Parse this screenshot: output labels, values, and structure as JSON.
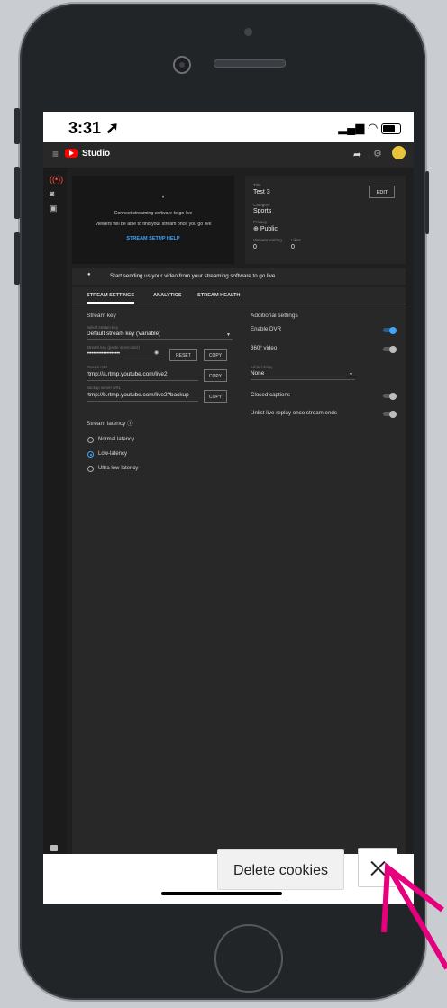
{
  "status_bar": {
    "time": "3:31"
  },
  "studio": {
    "brand": "Studio",
    "preview": {
      "line1": "Connect streaming software to go live",
      "line2": "Viewers will be able to find your stream once you go live",
      "help": "STREAM SETUP HELP"
    },
    "details": {
      "title_label": "Title",
      "title": "Test 3",
      "category_label": "Category",
      "category": "Sports",
      "privacy_label": "Privacy",
      "privacy": "Public",
      "viewers_label": "Viewers waiting",
      "viewers": "0",
      "likes_label": "Likes",
      "likes": "0",
      "edit_label": "EDIT"
    },
    "banner": "Start sending us your video from your streaming software to go live",
    "tabs": [
      "STREAM SETTINGS",
      "ANALYTICS",
      "STREAM HEALTH"
    ],
    "stream_key": {
      "section": "Stream key",
      "select_label": "Select stream key",
      "select_value": "Default stream key (Variable)",
      "key_label": "Stream key (paste in encoder)",
      "key_value": "••••••••••••••••••••",
      "reset_label": "RESET",
      "copy_label": "COPY",
      "url_label": "Stream URL",
      "url_value": "rtmp://a.rtmp.youtube.com/live2",
      "backup_label": "Backup server URL",
      "backup_value": "rtmp://b.rtmp.youtube.com/live2?backup"
    },
    "latency": {
      "section": "Stream latency",
      "options": [
        "Normal latency",
        "Low-latency",
        "Ultra low-latency"
      ],
      "selected": "Low-latency"
    },
    "additional": {
      "section": "Additional settings",
      "dvr": "Enable DVR",
      "dvr_on": true,
      "video360": "360° video",
      "delay_label": "Added delay",
      "delay_value": "None",
      "captions": "Closed captions",
      "unlist": "Unlist live replay once stream ends"
    }
  },
  "overlay": {
    "delete_cookies": "Delete cookies"
  },
  "colors": {
    "arrow": "#e6007e",
    "accent": "#3ea6ff",
    "brand": "#ff0000"
  }
}
